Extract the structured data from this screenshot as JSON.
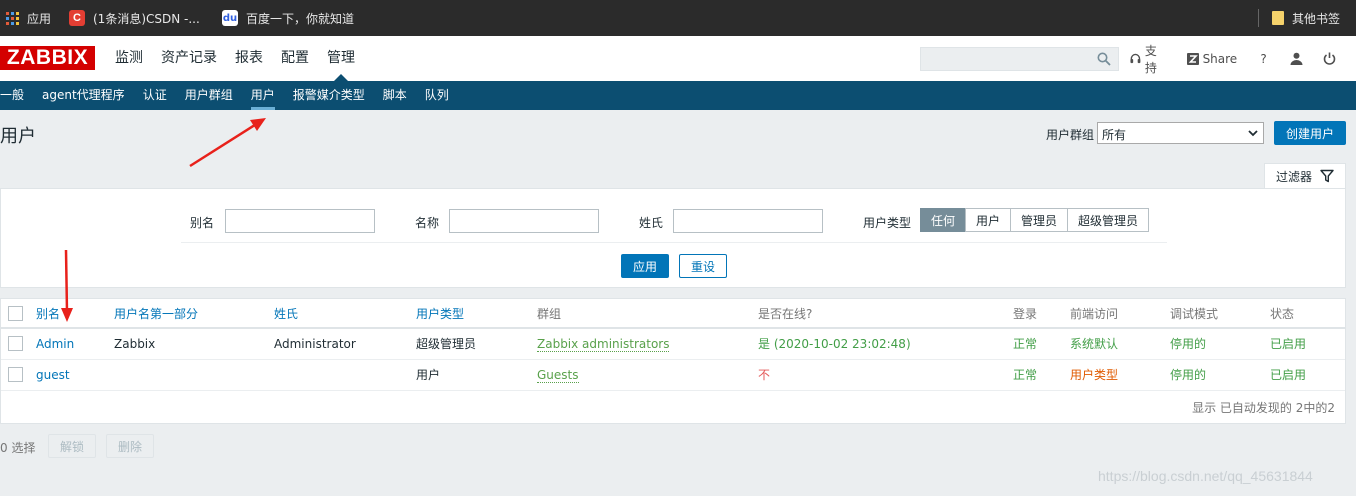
{
  "bookmarks": {
    "apps": "应用",
    "csdn": "(1条消息)CSDN -...",
    "baidu": "百度一下，你就知道",
    "other": "其他书签",
    "csdn_glyph": "C",
    "baidu_glyph": "du"
  },
  "header": {
    "logo": "ZABBIX",
    "menu": [
      "监测",
      "资产记录",
      "报表",
      "配置",
      "管理"
    ],
    "support": "支持",
    "share": "Share",
    "help": "?"
  },
  "subnav": [
    "一般",
    "agent代理程序",
    "认证",
    "用户群组",
    "用户",
    "报警媒介类型",
    "脚本",
    "队列"
  ],
  "page": {
    "title": "用户",
    "group_label": "用户群组",
    "group_value": "所有",
    "create_button": "创建用户"
  },
  "filter": {
    "tab": "过滤器",
    "alias_label": "别名",
    "name_label": "名称",
    "surname_label": "姓氏",
    "type_label": "用户类型",
    "type_options": [
      "任何",
      "用户",
      "管理员",
      "超级管理员"
    ],
    "type_selected": "任何",
    "apply": "应用",
    "reset": "重设"
  },
  "table": {
    "columns": [
      "别名",
      "用户名第一部分",
      "姓氏",
      "用户类型",
      "群组",
      "是否在线?",
      "登录",
      "前端访问",
      "调试模式",
      "状态"
    ],
    "rows": [
      {
        "alias": "Admin",
        "name": "Zabbix",
        "surname": "Administrator",
        "type": "超级管理员",
        "group": "Zabbix administrators",
        "online": "是 (2020-10-02 23:02:48)",
        "login": "正常",
        "frontend": "系统默认",
        "debug": "停用的",
        "status": "已启用"
      },
      {
        "alias": "guest",
        "name": "",
        "surname": "",
        "type": "用户",
        "group": "Guests",
        "online": "不",
        "login": "正常",
        "frontend": "用户类型",
        "debug": "停用的",
        "status": "已启用"
      }
    ],
    "footer": "显示 已自动发现的 2中的2"
  },
  "actions": {
    "selected": "0 选择",
    "unlock": "解锁",
    "delete": "删除"
  },
  "watermark": "https://blog.csdn.net/qq_45631844",
  "colors": {
    "brand": "#d40000",
    "nav": "#0c4e71",
    "primary": "#0275b8",
    "annotation_arrow": "#e8211b"
  },
  "icons": [
    "apps-grid-icon",
    "csdn-icon",
    "baidu-icon",
    "bookmark-folder-icon",
    "search-icon",
    "headset-icon",
    "share-icon",
    "user-icon",
    "power-icon",
    "filter-icon",
    "chevron-down-icon"
  ]
}
